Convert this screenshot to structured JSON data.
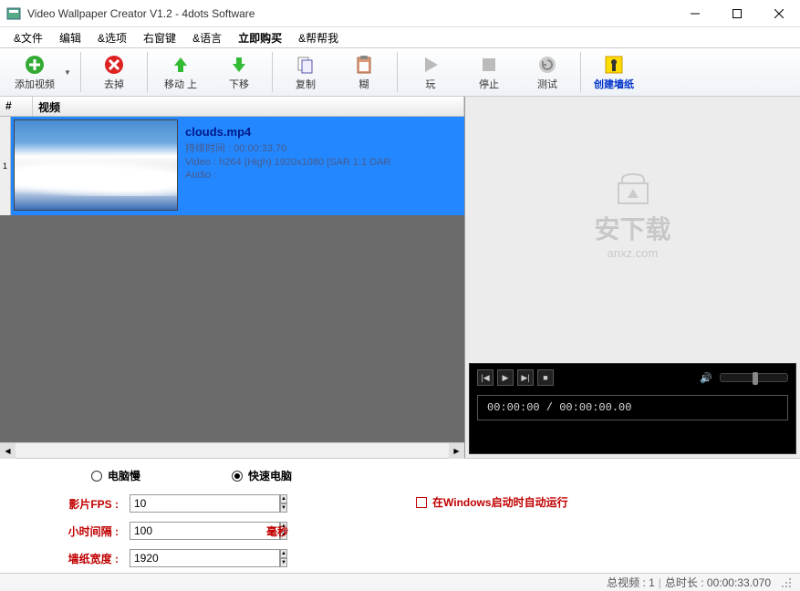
{
  "window": {
    "title": "Video Wallpaper Creator V1.2 - 4dots Software"
  },
  "menu": {
    "file": "&文件",
    "edit": "编辑",
    "options": "&选项",
    "context": "右窗键",
    "language": "&语言",
    "buy": "立即购买",
    "help": "&帮帮我"
  },
  "toolbar": {
    "add": "添加视频",
    "remove": "去掉",
    "moveup": "移动 上",
    "movedown": "下移",
    "copy": "复制",
    "paste": "糊",
    "play": "玩",
    "stop": "停止",
    "test": "测试",
    "create": "创建墙纸"
  },
  "table": {
    "col_idx": "#",
    "col_video": "视频",
    "rows": [
      {
        "index": "1",
        "filename": "clouds.mp4",
        "duration_label": "持续时间 : 00:00:33.70",
        "video_info": "Video : h264 (High) 1920x1080 [SAR 1:1 DAR",
        "audio_info": "Audio :"
      }
    ]
  },
  "watermark": {
    "name": "安下载",
    "domain": "anxz.com"
  },
  "player": {
    "time": "00:00:00 / 00:00:00.00"
  },
  "settings": {
    "radio_slow": "电脑慢",
    "radio_fast": "快速电脑",
    "fps_label": "影片FPS :",
    "fps_value": "10",
    "interval_label": "小时间隔 :",
    "interval_value": "100",
    "interval_unit": "毫秒",
    "width_label": "墙纸宽度 :",
    "width_value": "1920",
    "autostart": "在Windows启动时自动运行"
  },
  "status": {
    "total_videos": "总视频 : 1",
    "total_duration": "总时长 : 00:00:33.070"
  }
}
